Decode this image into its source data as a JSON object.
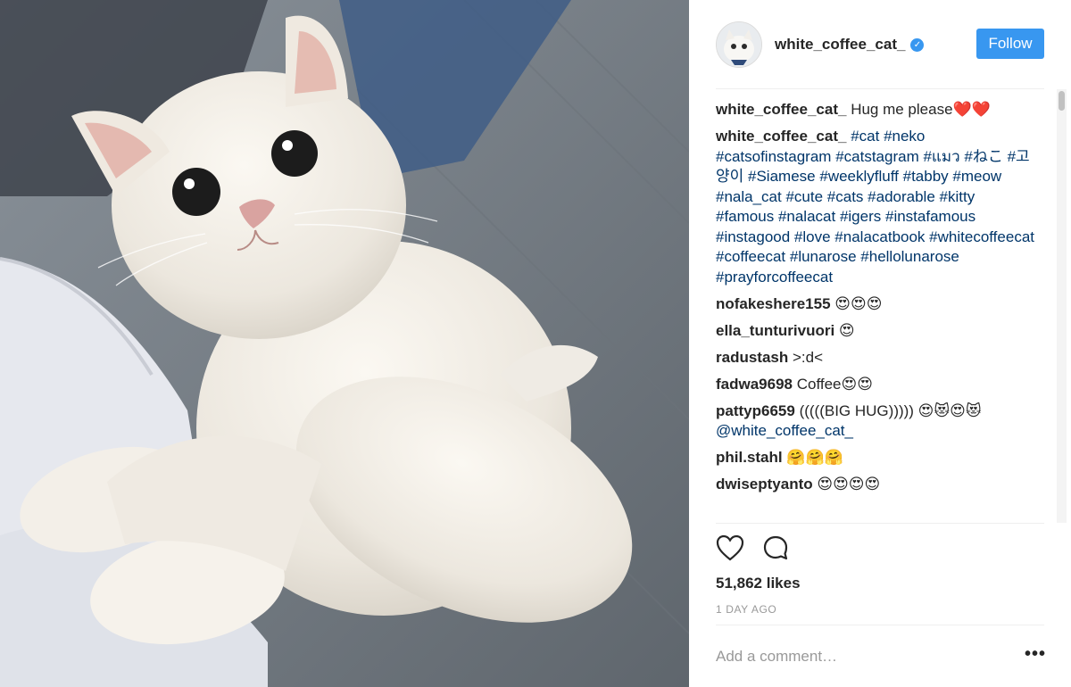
{
  "post": {
    "username": "white_coffee_cat_",
    "verified_icon": "verified-badge-icon",
    "follow_label": "Follow",
    "caption": {
      "user": "white_coffee_cat_",
      "text": "Hug me please❤️❤️"
    },
    "hashtag_comment": {
      "user": "white_coffee_cat_",
      "tags": [
        "#cat",
        "#neko",
        "#catsofinstagram",
        "#catstagram",
        "#แมว",
        "#ねこ",
        "#고양이",
        "#Siamese",
        "#weeklyfluff",
        "#tabby",
        "#meow",
        "#nala_cat",
        "#cute",
        "#cats",
        "#adorable",
        "#kitty",
        "#famous",
        "#nalacat",
        "#igers",
        "#instafamous",
        "#instagood",
        "#love",
        "#nalacatbook",
        "#whitecoffeecat",
        "#coffeecat",
        "#lunarose",
        "#hellolunarose",
        "#prayforcoffeecat"
      ]
    },
    "comments": [
      {
        "user": "nofakeshere155",
        "text": "😍😍😍"
      },
      {
        "user": "ella_tunturivuori",
        "text": "😍"
      },
      {
        "user": "radustash",
        "text": ">:d<"
      },
      {
        "user": "fadwa9698",
        "text": "Coffee😍😍"
      },
      {
        "user": "pattyp6659",
        "text": "(((((BIG HUG))))) 😍😻😍😻",
        "mention": "@white_coffee_cat_"
      },
      {
        "user": "phil.stahl",
        "text": "🤗🤗🤗"
      },
      {
        "user": "dwiseptyanto",
        "text": "😍😍😍😍"
      }
    ],
    "likes": "51,862 likes",
    "time": "1 DAY AGO",
    "comment_placeholder": "Add a comment…",
    "more_label": "•••",
    "icons": {
      "like": "heart-outline-icon",
      "comment": "comment-bubble-icon",
      "more": "more-options-icon"
    },
    "colors": {
      "accent": "#3897f0",
      "hashtag": "#003569",
      "muted": "#999999"
    }
  }
}
